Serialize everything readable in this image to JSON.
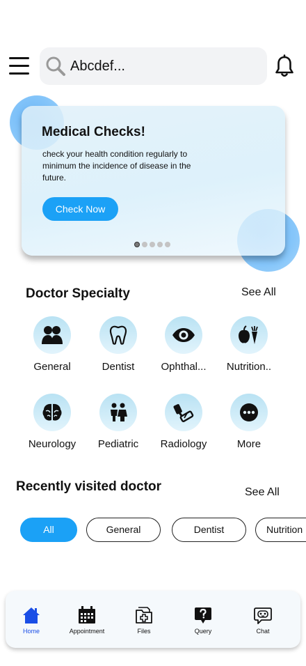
{
  "search": {
    "value": "Abcdef..."
  },
  "banner": {
    "title": "Medical Checks!",
    "description": "check your health condition regularly to minimum the incidence of disease in the future.",
    "button_label": "Check Now",
    "carousel": {
      "active_index": 0,
      "count": 5
    }
  },
  "specialty": {
    "title": "Doctor Specialty",
    "see_all": "See All",
    "items": [
      {
        "label": "General",
        "icon": "people-icon"
      },
      {
        "label": "Dentist",
        "icon": "tooth-icon"
      },
      {
        "label": "Ophthal...",
        "icon": "eye-icon"
      },
      {
        "label": "Nutrition..",
        "icon": "fruit-icon"
      },
      {
        "label": "Neurology",
        "icon": "brain-icon"
      },
      {
        "label": "Pediatric",
        "icon": "children-icon"
      },
      {
        "label": "Radiology",
        "icon": "radiology-icon"
      },
      {
        "label": "More",
        "icon": "more-icon"
      }
    ]
  },
  "recent": {
    "title": "Recently visited doctor",
    "see_all": "See All",
    "filters": [
      "All",
      "General",
      "Dentist",
      "Nutrition"
    ],
    "active_filter": "All"
  },
  "tabbar": {
    "items": [
      {
        "label": "Home",
        "icon": "home-icon"
      },
      {
        "label": "Appointment",
        "icon": "calendar-icon"
      },
      {
        "label": "Files",
        "icon": "medical-folder-icon"
      },
      {
        "label": "Query",
        "icon": "question-icon"
      },
      {
        "label": "Chat",
        "icon": "chat-bot-icon"
      }
    ],
    "active": "Home"
  },
  "colors": {
    "accent": "#1ba1f6",
    "active_tab": "#1a4ee6",
    "blob": "#8ac8fa"
  }
}
